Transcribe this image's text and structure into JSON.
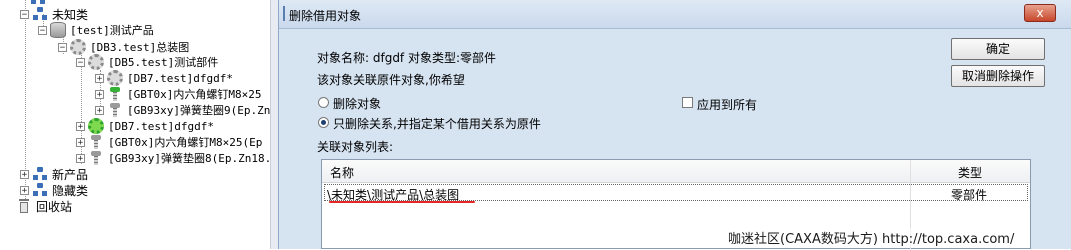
{
  "tree": {
    "nodes": [
      {
        "label": "未知类"
      },
      {
        "label": "[test]测试产品"
      },
      {
        "label": "[DB3.test]总装图"
      },
      {
        "label": "[DB5.test]测试部件"
      },
      {
        "label": "[DB7.test]dfgdf*"
      },
      {
        "label": "[GBT0x]内六角螺钉M8×25"
      },
      {
        "label": "[GB93xy]弹簧垫圈9(Ep.Zn"
      },
      {
        "label": "[DB7.test]dfgdf*"
      },
      {
        "label": "[GBT0x]内六角螺钉M8×25(Ep"
      },
      {
        "label": "[GB93xy]弹簧垫圈8(Ep.Zn18."
      },
      {
        "label": "新产品"
      },
      {
        "label": "隐藏类"
      },
      {
        "label": "回收站"
      }
    ]
  },
  "dialog": {
    "title": "删除借用对象",
    "close_label": "x",
    "object_info": "对象名称: dfgdf 对象类型:零部件",
    "prompt": "该对象关联原件对象,你希望",
    "options": [
      {
        "label": "删除对象",
        "selected": false
      },
      {
        "label": "只删除关系,并指定某个借用关系为原件",
        "selected": true
      }
    ],
    "apply_all_label": "应用到所有",
    "apply_all_checked": false,
    "list_label": "关联对象列表:",
    "buttons": {
      "ok": "确定",
      "cancel": "取消删除操作"
    },
    "table": {
      "columns": [
        "名称",
        "类型"
      ],
      "rows": [
        {
          "name": "\\未知类\\测试产品\\总装图",
          "type": "零部件"
        }
      ]
    }
  },
  "watermark": "咖迷社区(CAXA数码大方) http://top.caxa.com/",
  "colors": {
    "dialog_bg": "#d6e3f1",
    "close_button": "#c7462b",
    "highlight_underline": "#e32626"
  }
}
